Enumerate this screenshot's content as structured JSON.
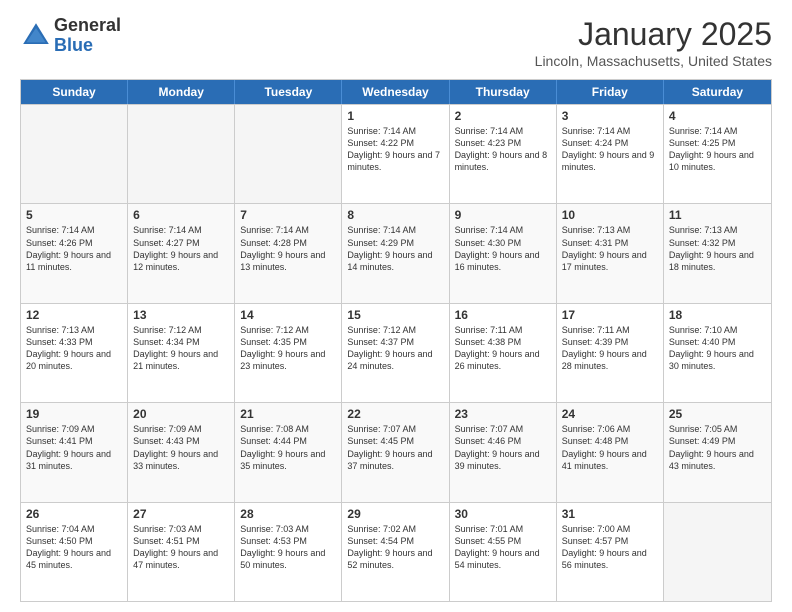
{
  "logo": {
    "general": "General",
    "blue": "Blue"
  },
  "title": "January 2025",
  "location": "Lincoln, Massachusetts, United States",
  "days": [
    "Sunday",
    "Monday",
    "Tuesday",
    "Wednesday",
    "Thursday",
    "Friday",
    "Saturday"
  ],
  "rows": [
    [
      {
        "day": "",
        "sunrise": "",
        "sunset": "",
        "daylight": "",
        "empty": true
      },
      {
        "day": "",
        "sunrise": "",
        "sunset": "",
        "daylight": "",
        "empty": true
      },
      {
        "day": "",
        "sunrise": "",
        "sunset": "",
        "daylight": "",
        "empty": true
      },
      {
        "day": "1",
        "sunrise": "Sunrise: 7:14 AM",
        "sunset": "Sunset: 4:22 PM",
        "daylight": "Daylight: 9 hours and 7 minutes."
      },
      {
        "day": "2",
        "sunrise": "Sunrise: 7:14 AM",
        "sunset": "Sunset: 4:23 PM",
        "daylight": "Daylight: 9 hours and 8 minutes."
      },
      {
        "day": "3",
        "sunrise": "Sunrise: 7:14 AM",
        "sunset": "Sunset: 4:24 PM",
        "daylight": "Daylight: 9 hours and 9 minutes."
      },
      {
        "day": "4",
        "sunrise": "Sunrise: 7:14 AM",
        "sunset": "Sunset: 4:25 PM",
        "daylight": "Daylight: 9 hours and 10 minutes."
      }
    ],
    [
      {
        "day": "5",
        "sunrise": "Sunrise: 7:14 AM",
        "sunset": "Sunset: 4:26 PM",
        "daylight": "Daylight: 9 hours and 11 minutes."
      },
      {
        "day": "6",
        "sunrise": "Sunrise: 7:14 AM",
        "sunset": "Sunset: 4:27 PM",
        "daylight": "Daylight: 9 hours and 12 minutes."
      },
      {
        "day": "7",
        "sunrise": "Sunrise: 7:14 AM",
        "sunset": "Sunset: 4:28 PM",
        "daylight": "Daylight: 9 hours and 13 minutes."
      },
      {
        "day": "8",
        "sunrise": "Sunrise: 7:14 AM",
        "sunset": "Sunset: 4:29 PM",
        "daylight": "Daylight: 9 hours and 14 minutes."
      },
      {
        "day": "9",
        "sunrise": "Sunrise: 7:14 AM",
        "sunset": "Sunset: 4:30 PM",
        "daylight": "Daylight: 9 hours and 16 minutes."
      },
      {
        "day": "10",
        "sunrise": "Sunrise: 7:13 AM",
        "sunset": "Sunset: 4:31 PM",
        "daylight": "Daylight: 9 hours and 17 minutes."
      },
      {
        "day": "11",
        "sunrise": "Sunrise: 7:13 AM",
        "sunset": "Sunset: 4:32 PM",
        "daylight": "Daylight: 9 hours and 18 minutes."
      }
    ],
    [
      {
        "day": "12",
        "sunrise": "Sunrise: 7:13 AM",
        "sunset": "Sunset: 4:33 PM",
        "daylight": "Daylight: 9 hours and 20 minutes."
      },
      {
        "day": "13",
        "sunrise": "Sunrise: 7:12 AM",
        "sunset": "Sunset: 4:34 PM",
        "daylight": "Daylight: 9 hours and 21 minutes."
      },
      {
        "day": "14",
        "sunrise": "Sunrise: 7:12 AM",
        "sunset": "Sunset: 4:35 PM",
        "daylight": "Daylight: 9 hours and 23 minutes."
      },
      {
        "day": "15",
        "sunrise": "Sunrise: 7:12 AM",
        "sunset": "Sunset: 4:37 PM",
        "daylight": "Daylight: 9 hours and 24 minutes."
      },
      {
        "day": "16",
        "sunrise": "Sunrise: 7:11 AM",
        "sunset": "Sunset: 4:38 PM",
        "daylight": "Daylight: 9 hours and 26 minutes."
      },
      {
        "day": "17",
        "sunrise": "Sunrise: 7:11 AM",
        "sunset": "Sunset: 4:39 PM",
        "daylight": "Daylight: 9 hours and 28 minutes."
      },
      {
        "day": "18",
        "sunrise": "Sunrise: 7:10 AM",
        "sunset": "Sunset: 4:40 PM",
        "daylight": "Daylight: 9 hours and 30 minutes."
      }
    ],
    [
      {
        "day": "19",
        "sunrise": "Sunrise: 7:09 AM",
        "sunset": "Sunset: 4:41 PM",
        "daylight": "Daylight: 9 hours and 31 minutes."
      },
      {
        "day": "20",
        "sunrise": "Sunrise: 7:09 AM",
        "sunset": "Sunset: 4:43 PM",
        "daylight": "Daylight: 9 hours and 33 minutes."
      },
      {
        "day": "21",
        "sunrise": "Sunrise: 7:08 AM",
        "sunset": "Sunset: 4:44 PM",
        "daylight": "Daylight: 9 hours and 35 minutes."
      },
      {
        "day": "22",
        "sunrise": "Sunrise: 7:07 AM",
        "sunset": "Sunset: 4:45 PM",
        "daylight": "Daylight: 9 hours and 37 minutes."
      },
      {
        "day": "23",
        "sunrise": "Sunrise: 7:07 AM",
        "sunset": "Sunset: 4:46 PM",
        "daylight": "Daylight: 9 hours and 39 minutes."
      },
      {
        "day": "24",
        "sunrise": "Sunrise: 7:06 AM",
        "sunset": "Sunset: 4:48 PM",
        "daylight": "Daylight: 9 hours and 41 minutes."
      },
      {
        "day": "25",
        "sunrise": "Sunrise: 7:05 AM",
        "sunset": "Sunset: 4:49 PM",
        "daylight": "Daylight: 9 hours and 43 minutes."
      }
    ],
    [
      {
        "day": "26",
        "sunrise": "Sunrise: 7:04 AM",
        "sunset": "Sunset: 4:50 PM",
        "daylight": "Daylight: 9 hours and 45 minutes."
      },
      {
        "day": "27",
        "sunrise": "Sunrise: 7:03 AM",
        "sunset": "Sunset: 4:51 PM",
        "daylight": "Daylight: 9 hours and 47 minutes."
      },
      {
        "day": "28",
        "sunrise": "Sunrise: 7:03 AM",
        "sunset": "Sunset: 4:53 PM",
        "daylight": "Daylight: 9 hours and 50 minutes."
      },
      {
        "day": "29",
        "sunrise": "Sunrise: 7:02 AM",
        "sunset": "Sunset: 4:54 PM",
        "daylight": "Daylight: 9 hours and 52 minutes."
      },
      {
        "day": "30",
        "sunrise": "Sunrise: 7:01 AM",
        "sunset": "Sunset: 4:55 PM",
        "daylight": "Daylight: 9 hours and 54 minutes."
      },
      {
        "day": "31",
        "sunrise": "Sunrise: 7:00 AM",
        "sunset": "Sunset: 4:57 PM",
        "daylight": "Daylight: 9 hours and 56 minutes."
      },
      {
        "day": "",
        "sunrise": "",
        "sunset": "",
        "daylight": "",
        "empty": true
      }
    ]
  ]
}
